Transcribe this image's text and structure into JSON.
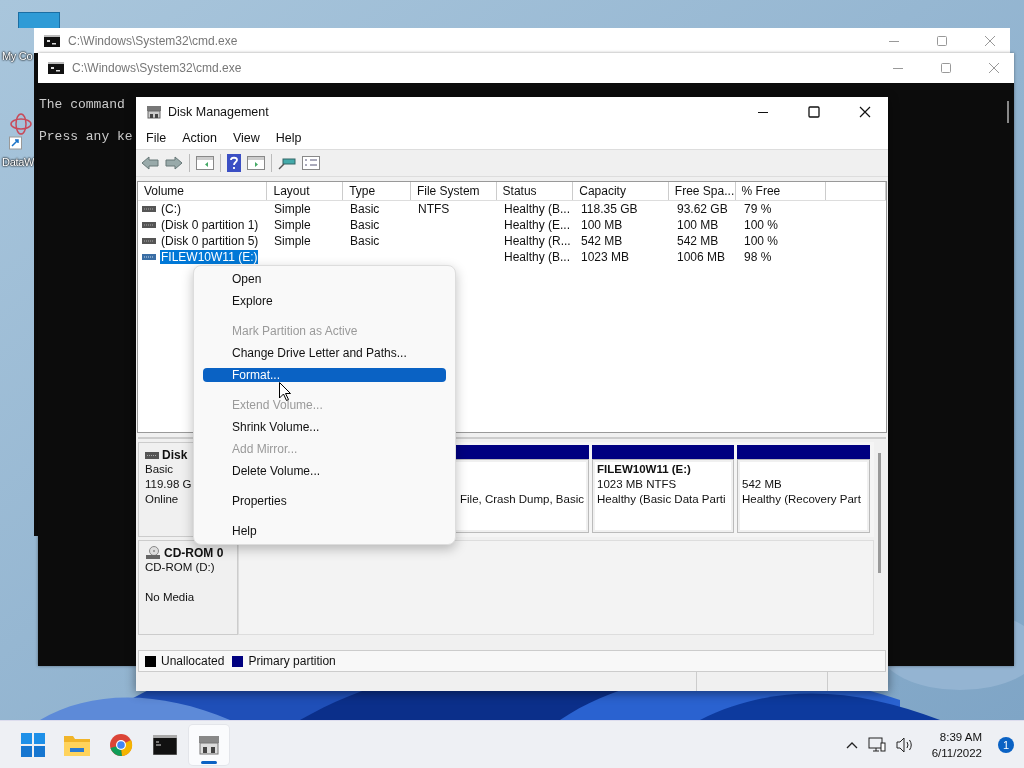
{
  "desktop": {
    "icons": [
      {
        "label": "My Co",
        "kind": "computer"
      },
      {
        "label": "DataW",
        "kind": "shortcut"
      }
    ]
  },
  "cmd_windows": [
    {
      "title": "C:\\Windows\\System32\\cmd.exe"
    },
    {
      "title": "C:\\Windows\\System32\\cmd.exe",
      "lines": [
        "The command",
        "Press any ke"
      ]
    }
  ],
  "disk_management": {
    "title": "Disk Management",
    "menu": [
      "File",
      "Action",
      "View",
      "Help"
    ],
    "columns": [
      "Volume",
      "Layout",
      "Type",
      "File System",
      "Status",
      "Capacity",
      "Free Spa...",
      "% Free"
    ],
    "rows": [
      {
        "cells": [
          "(C:)",
          "Simple",
          "Basic",
          "NTFS",
          "Healthy (B...",
          "118.35 GB",
          "93.62 GB",
          "79 %"
        ],
        "selected": false
      },
      {
        "cells": [
          "(Disk 0 partition 1)",
          "Simple",
          "Basic",
          "",
          "Healthy (E...",
          "100 MB",
          "100 MB",
          "100 %"
        ],
        "selected": false
      },
      {
        "cells": [
          "(Disk 0 partition 5)",
          "Simple",
          "Basic",
          "",
          "Healthy (R...",
          "542 MB",
          "542 MB",
          "100 %"
        ],
        "selected": false
      },
      {
        "cells": [
          "FILEW10W11 (E:)",
          null,
          null,
          null,
          "Healthy (B...",
          "1023 MB",
          "1006 MB",
          "98 %"
        ],
        "selected": true
      }
    ],
    "disks": [
      {
        "kind": "disk",
        "name": "Disk",
        "lines": [
          "Basic",
          "119.98 G",
          "Online"
        ],
        "partitions": [
          {
            "lines": [
              "File, Crash Dump, Basic"
            ],
            "color": "#000080"
          },
          {
            "title": "FILEW10W11  (E:)",
            "lines": [
              "1023 MB NTFS",
              "Healthy (Basic Data Parti"
            ],
            "color": "#000080"
          },
          {
            "lines": [
              "542 MB",
              "Healthy (Recovery Part"
            ],
            "color": "#000080"
          }
        ]
      },
      {
        "kind": "cdrom",
        "name": "CD-ROM 0",
        "lines": [
          "CD-ROM (D:)",
          "No Media"
        ]
      }
    ],
    "legend": [
      {
        "label": "Unallocated",
        "color": "#000000"
      },
      {
        "label": "Primary partition",
        "color": "#000080"
      }
    ]
  },
  "context_menu": {
    "items": [
      {
        "kind": "item",
        "label": "Open",
        "disabled": false,
        "selected": false
      },
      {
        "kind": "item",
        "label": "Explore",
        "disabled": false,
        "selected": false
      },
      {
        "kind": "separator"
      },
      {
        "kind": "item",
        "label": "Mark Partition as Active",
        "disabled": true,
        "selected": false
      },
      {
        "kind": "item",
        "label": "Change Drive Letter and Paths...",
        "disabled": false,
        "selected": false
      },
      {
        "kind": "item",
        "label": "Format...",
        "disabled": false,
        "selected": true
      },
      {
        "kind": "separator"
      },
      {
        "kind": "item",
        "label": "Extend Volume...",
        "disabled": true,
        "selected": false
      },
      {
        "kind": "item",
        "label": "Shrink Volume...",
        "disabled": false,
        "selected": false
      },
      {
        "kind": "item",
        "label": "Add Mirror...",
        "disabled": true,
        "selected": false
      },
      {
        "kind": "item",
        "label": "Delete Volume...",
        "disabled": false,
        "selected": false
      },
      {
        "kind": "separator"
      },
      {
        "kind": "item",
        "label": "Properties",
        "disabled": false,
        "selected": false
      },
      {
        "kind": "separator"
      },
      {
        "kind": "item",
        "label": "Help",
        "disabled": false,
        "selected": false
      }
    ]
  },
  "taskbar": {
    "apps": [
      {
        "kind": "start",
        "active": false
      },
      {
        "kind": "folder",
        "active": false
      },
      {
        "kind": "browser",
        "active": false
      },
      {
        "kind": "terminal",
        "active": false
      },
      {
        "kind": "diskmgmt",
        "active": true
      }
    ],
    "time": "8:39 AM",
    "date": "6/11/2022",
    "notifications": "1"
  }
}
